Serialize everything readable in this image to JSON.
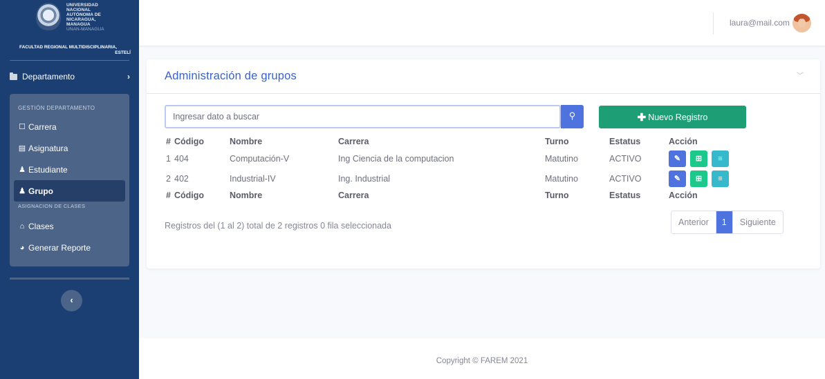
{
  "brand": {
    "university_lines": [
      "UNIVERSIDAD",
      "NACIONAL",
      "AUTÓNOMA DE",
      "NICARAGUA,",
      "MANAGUA"
    ],
    "university_sub": "UNAN-MANAGUA",
    "faculty_line1": "FACULTAD REGIONAL MULTIDISCIPLINARIA,",
    "faculty_line2": "ESTELÍ"
  },
  "sidebar": {
    "department_label": "Departamento",
    "section_heading": "GESTIÓN DEPARTAMENTO",
    "items": [
      {
        "label": "Carrera",
        "icon": "bookmark-icon"
      },
      {
        "label": "Asignatura",
        "icon": "book-icon"
      },
      {
        "label": "Estudiante",
        "icon": "user-graduate-icon"
      },
      {
        "label": "Grupo",
        "icon": "users-icon"
      }
    ],
    "section_heading2": "ASIGNACION DE CLASES",
    "items2": [
      {
        "label": "Clases",
        "icon": "university-icon"
      },
      {
        "label": "Generar Reporte",
        "icon": "pie-chart-icon"
      }
    ],
    "active": "Grupo"
  },
  "topbar": {
    "user_email": "laura@mail.com"
  },
  "card": {
    "title": "Administración de grupos",
    "search_placeholder": "Ingresar dato a buscar",
    "new_button": "Nuevo Registro"
  },
  "table": {
    "headers": [
      "#",
      "Código",
      "Nombre",
      "Carrera",
      "Turno",
      "Estatus",
      "Acción"
    ],
    "rows": [
      {
        "num": "1",
        "codigo": "404",
        "nombre": "Computación-V",
        "carrera": "Ing Ciencia de la computacion",
        "turno": "Matutino",
        "estatus": "ACTIVO"
      },
      {
        "num": "2",
        "codigo": "402",
        "nombre": "Industrial-IV",
        "carrera": "Ing. Industrial",
        "turno": "Matutino",
        "estatus": "ACTIVO"
      }
    ]
  },
  "info_text": "Registros del (1 al 2) total de 2 registros   0 fila seleccionada",
  "pager": {
    "prev": "Anterior",
    "current": "1",
    "next": "Siguiente"
  },
  "footer": "Copyright © FAREM 2021",
  "colors": {
    "sidebar_bg": "#1b3f73",
    "menu_panel": "#4b6488",
    "primary": "#4e73df",
    "success": "#1e9e75",
    "teal": "#36b9cc"
  }
}
